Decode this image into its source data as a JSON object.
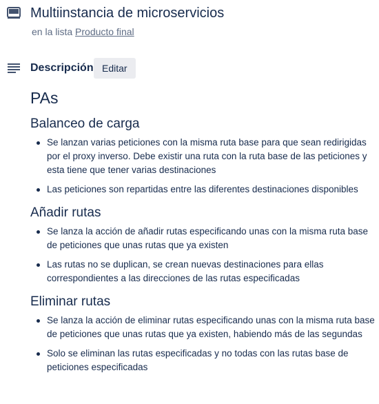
{
  "card": {
    "title": "Multiinstancia de microservicios",
    "list_prefix": "en la lista ",
    "list_name": "Producto final",
    "icon": "card-icon"
  },
  "description": {
    "label": "Descripción",
    "edit_label": "Editar",
    "icon": "description-lines-icon",
    "heading": "PAs",
    "sections": [
      {
        "title": "Balanceo de carga",
        "items": [
          "Se lanzan varias peticiones con la misma ruta base para que sean redirigidas por el proxy inverso. Debe existir una ruta con la ruta base de las peticiones y esta tiene que tener varias destinaciones",
          "Las peticiones son repartidas entre las diferentes destinaciones disponibles"
        ]
      },
      {
        "title": "Añadir rutas",
        "items": [
          "Se lanza la acción de añadir rutas especificando unas con la misma ruta base de peticiones que unas rutas que ya existen",
          "Las rutas no se duplican, se crean nuevas destinaciones para ellas correspondientes a las direcciones de las rutas especificadas"
        ]
      },
      {
        "title": "Eliminar rutas",
        "items": [
          "Se lanza la acción de eliminar rutas especificando unas con la misma ruta base de peticiones que unas rutas que ya existen, habiendo más de las segundas",
          "Solo se eliminan las rutas especificadas y no todas con las rutas base de peticiones especificadas"
        ]
      }
    ]
  }
}
